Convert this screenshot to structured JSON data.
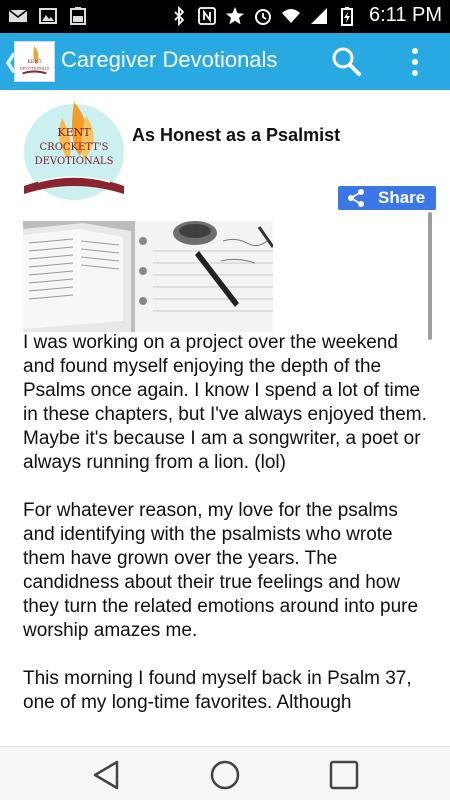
{
  "status_bar": {
    "time": "6:11 PM",
    "icons": [
      "mail-icon",
      "image-icon",
      "battery-icon",
      "bluetooth-icon",
      "nfc-icon",
      "star-icon",
      "alarm-icon",
      "wifi-icon",
      "signal-icon",
      "battery-charging-icon"
    ]
  },
  "app_bar": {
    "title": "Caregiver Devotionals",
    "icons": [
      "back-chevron-icon",
      "app-logo-icon",
      "search-icon",
      "more-vert-icon"
    ]
  },
  "logo": {
    "lines": [
      "KENT",
      "CROCKETT'S",
      "DEVOTIONALS"
    ]
  },
  "post": {
    "title": "As Honest as a Psalmist",
    "share_label": "Share",
    "paragraphs": [
      "I was working on a project over the weekend and found myself enjoying the depth of the Psalms once again. I know I spend a lot of time in these chapters, but I've always enjoyed them. Maybe it's because I am a songwriter, a poet or always running from a lion. (lol)",
      "For whatever reason, my love for the psalms and identifying with the psalmists who wrote them have grown over the years. The candidness about their true feelings and how they turn the related emotions around into pure worship amazes me.",
      "This morning I found myself back in Psalm 37, one of my long-time favorites. Although"
    ]
  },
  "nav_bar": {
    "icons": [
      "back-triangle-icon",
      "home-circle-icon",
      "recents-square-icon"
    ]
  },
  "colors": {
    "app_bar": "#29a9e1",
    "share_button": "#3b77e6",
    "status_bar": "#000000"
  }
}
